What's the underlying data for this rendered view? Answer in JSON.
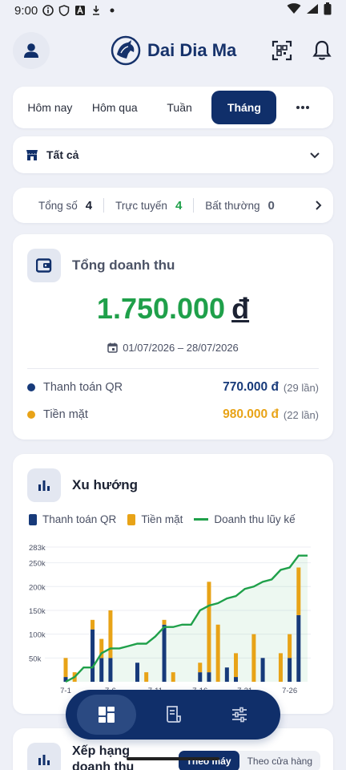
{
  "status": {
    "time": "9:00"
  },
  "header": {
    "brand": "Dai Dia Ma"
  },
  "tabs": [
    {
      "label": "Hôm nay",
      "active": false
    },
    {
      "label": "Hôm qua",
      "active": false
    },
    {
      "label": "Tuần",
      "active": false
    },
    {
      "label": "Tháng",
      "active": true
    }
  ],
  "station": {
    "label": "Tất cả"
  },
  "stats": [
    {
      "label": "Tổng số",
      "value": "4"
    },
    {
      "label": "Trực tuyến",
      "value": "4"
    },
    {
      "label": "Bất thường",
      "value": "0"
    }
  ],
  "revenue": {
    "title": "Tổng doanh thu",
    "amount": "1.750.000",
    "currency": "đ",
    "date_range": "01/07/2026 – 28/07/2026",
    "rows": [
      {
        "label": "Thanh toán QR",
        "amount": "770.000 đ",
        "count": "(29 lần)",
        "color": "#173a7a"
      },
      {
        "label": "Tiền mặt",
        "amount": "980.000 đ",
        "count": "(22 lần)",
        "color": "#e8a317"
      }
    ]
  },
  "trend": {
    "title": "Xu hướng"
  },
  "colors": {
    "qr": "#173a7a",
    "cash": "#e8a317",
    "cumulative": "#1fa04a",
    "accent": "#102f6a"
  },
  "chart_data": {
    "type": "bar",
    "x": [
      "7-1",
      "7-2",
      "7-3",
      "7-4",
      "7-5",
      "7-6",
      "7-7",
      "7-8",
      "7-9",
      "7-10",
      "7-11",
      "7-12",
      "7-13",
      "7-14",
      "7-15",
      "7-16",
      "7-17",
      "7-18",
      "7-19",
      "7-20",
      "7-21",
      "7-22",
      "7-23",
      "7-24",
      "7-25",
      "7-26",
      "7-27",
      "7-28"
    ],
    "x_tick_labels": [
      "7-1",
      "7-6",
      "7-11",
      "7-16",
      "7-21",
      "7-26"
    ],
    "y_tick_labels": [
      "283k",
      "250k",
      "200k",
      "150k",
      "100k",
      "50k"
    ],
    "ylim": [
      0,
      283000
    ],
    "series": [
      {
        "name": "Thanh toán QR",
        "type": "bar",
        "values": [
          10000,
          0,
          0,
          110000,
          50000,
          50000,
          0,
          0,
          40000,
          0,
          0,
          120000,
          0,
          0,
          0,
          20000,
          20000,
          0,
          30000,
          10000,
          0,
          0,
          50000,
          0,
          0,
          50000,
          140000,
          0
        ]
      },
      {
        "name": "Tiền mặt",
        "type": "bar",
        "values": [
          40000,
          20000,
          0,
          20000,
          40000,
          100000,
          0,
          0,
          0,
          20000,
          0,
          10000,
          20000,
          0,
          0,
          20000,
          190000,
          120000,
          0,
          50000,
          0,
          100000,
          0,
          0,
          60000,
          50000,
          100000,
          0
        ]
      },
      {
        "name": "Doanh thu lũy kế",
        "type": "line",
        "values": [
          0,
          10000,
          30000,
          30000,
          60000,
          70000,
          70000,
          75000,
          80000,
          80000,
          95000,
          115000,
          115000,
          120000,
          120000,
          150000,
          160000,
          165000,
          175000,
          180000,
          195000,
          200000,
          210000,
          215000,
          235000,
          240000,
          265000,
          265000
        ]
      }
    ],
    "legend": "top"
  },
  "rank": {
    "title": "Xếp hạng doanh thu",
    "options": [
      "Theo máy",
      "Theo cửa hàng"
    ]
  }
}
